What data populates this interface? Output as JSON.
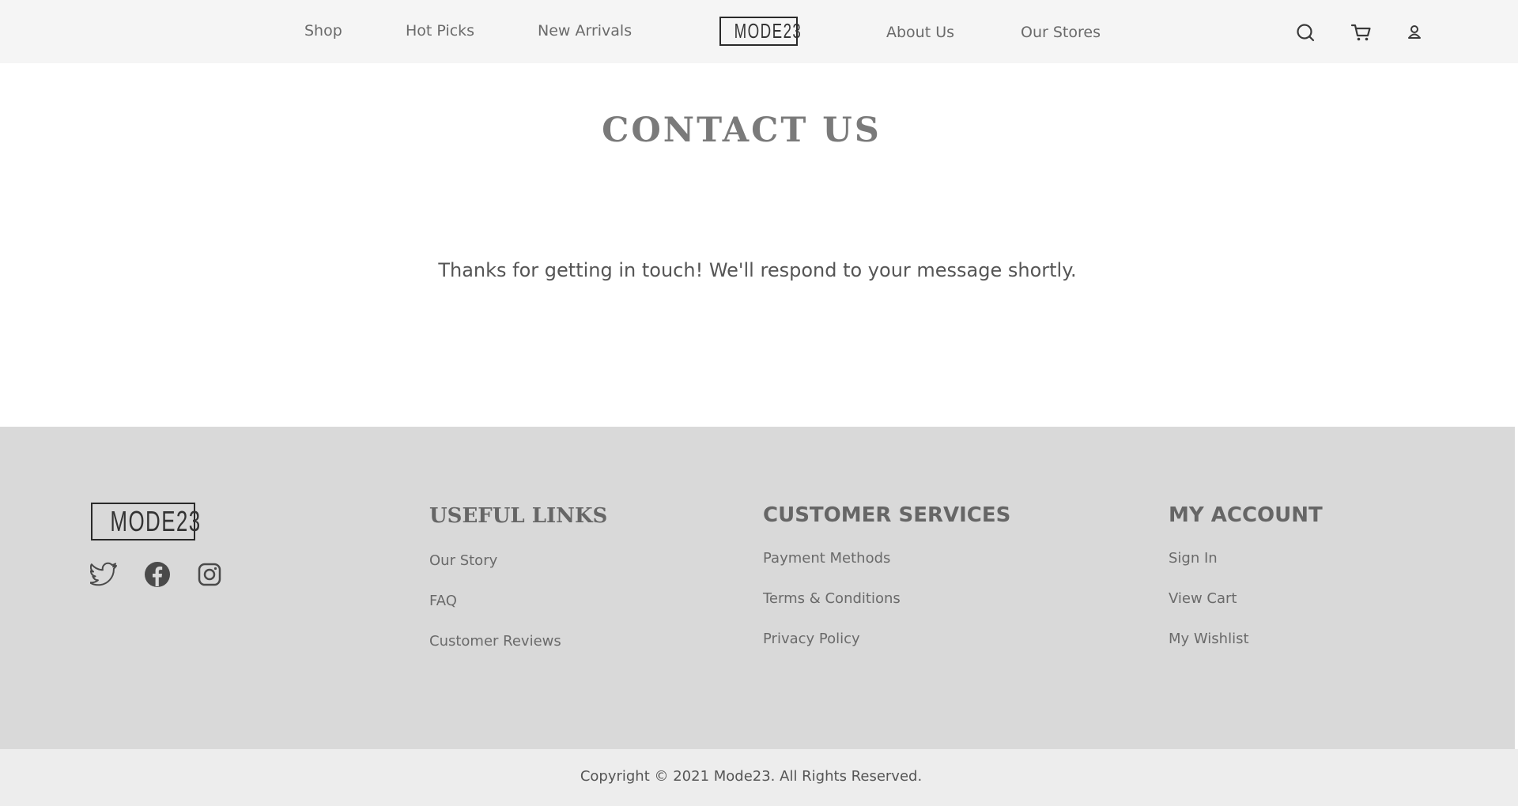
{
  "header": {
    "nav_left": [
      "Shop",
      "Hot Picks",
      "New Arrivals"
    ],
    "logo": "MODE23",
    "nav_right": [
      "About Us",
      "Our Stores"
    ],
    "icons": [
      "search-icon",
      "cart-icon",
      "user-icon"
    ]
  },
  "main": {
    "title": "CONTACT US",
    "message": "Thanks for getting in touch! We'll respond to your message shortly."
  },
  "footer": {
    "logo": "MODE23",
    "social_icons": [
      "twitter-icon",
      "facebook-icon",
      "instagram-icon"
    ],
    "columns": [
      {
        "title": "USEFUL LINKS",
        "links": [
          "Our Story",
          "FAQ",
          "Customer Reviews"
        ]
      },
      {
        "title": "CUSTOMER SERVICES",
        "links": [
          "Payment Methods",
          "Terms & Conditions",
          "Privacy Policy"
        ]
      },
      {
        "title": "MY ACCOUNT",
        "links": [
          "Sign In",
          "View Cart",
          "My Wishlist"
        ]
      }
    ],
    "copyright": "Copyright © 2021 Mode23. All Rights Reserved."
  },
  "colors": {
    "header_bg": "#f5f5f5",
    "footer_bg": "#d9d9d9",
    "copyright_bg": "#ededed",
    "title_text": "#7a7a7a"
  }
}
